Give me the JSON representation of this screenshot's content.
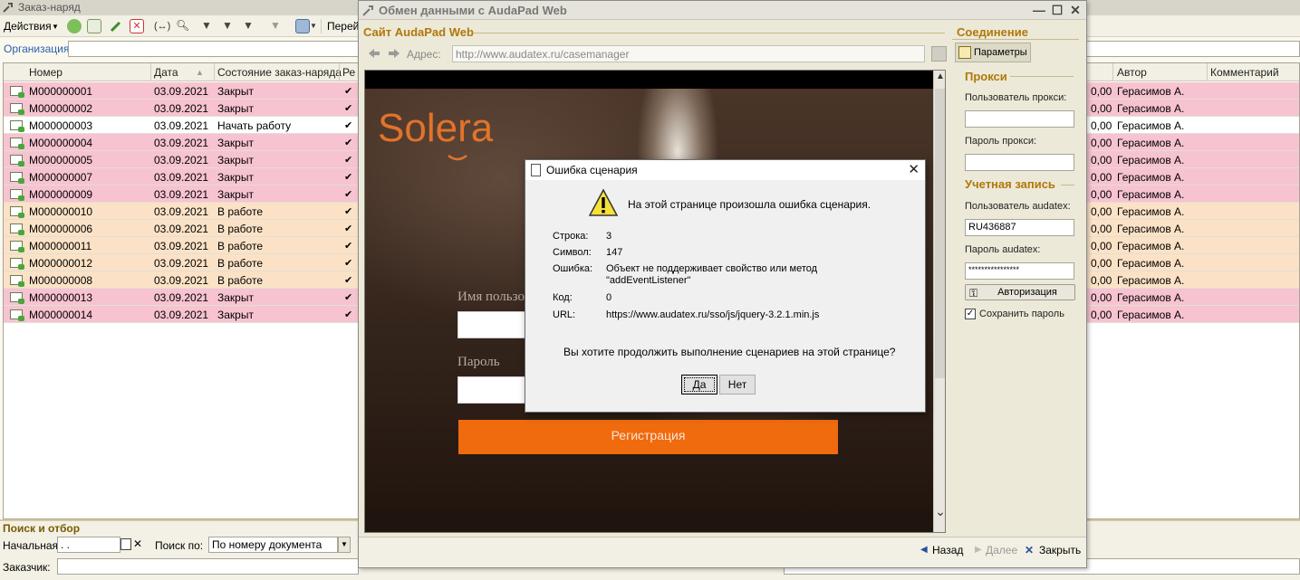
{
  "background": {
    "title": "Заказ-наряд",
    "toolbar": {
      "actions_label": "Действия",
      "goto_label": "Перей"
    },
    "org_label": "Организация:",
    "columns": [
      "Номер",
      "Дата",
      "Состояние заказ-наряда",
      "Ре",
      "Автор",
      "Комментарий"
    ],
    "rows": [
      {
        "number": "М000000001",
        "date": "03.09.2021",
        "state": "Закрыт",
        "sum": "0,00",
        "author": "Герасимов А.",
        "color": "pink"
      },
      {
        "number": "М000000002",
        "date": "03.09.2021",
        "state": "Закрыт",
        "sum": "0,00",
        "author": "Герасимов А.",
        "color": "pink"
      },
      {
        "number": "М000000003",
        "date": "03.09.2021",
        "state": "Начать работу",
        "sum": "0,00",
        "author": "Герасимов А.",
        "color": "white"
      },
      {
        "number": "М000000004",
        "date": "03.09.2021",
        "state": "Закрыт",
        "sum": "0,00",
        "author": "Герасимов А.",
        "color": "pink"
      },
      {
        "number": "М000000005",
        "date": "03.09.2021",
        "state": "Закрыт",
        "sum": "0,00",
        "author": "Герасимов А.",
        "color": "pink"
      },
      {
        "number": "М000000007",
        "date": "03.09.2021",
        "state": "Закрыт",
        "sum": "0,00",
        "author": "Герасимов А.",
        "color": "pink"
      },
      {
        "number": "М000000009",
        "date": "03.09.2021",
        "state": "Закрыт",
        "sum": "0,00",
        "author": "Герасимов А.",
        "color": "pink"
      },
      {
        "number": "М000000010",
        "date": "03.09.2021",
        "state": "В работе",
        "sum": "0,00",
        "author": "Герасимов А.",
        "color": "orange"
      },
      {
        "number": "М000000006",
        "date": "03.09.2021",
        "state": "В работе",
        "sum": "0,00",
        "author": "Герасимов А.",
        "color": "orange"
      },
      {
        "number": "М000000011",
        "date": "03.09.2021",
        "state": "В работе",
        "sum": "0,00",
        "author": "Герасимов А.",
        "color": "orange"
      },
      {
        "number": "М000000012",
        "date": "03.09.2021",
        "state": "В работе",
        "sum": "0,00",
        "author": "Герасимов А.",
        "color": "orange"
      },
      {
        "number": "М000000008",
        "date": "03.09.2021",
        "state": "В работе",
        "sum": "0,00",
        "author": "Герасимов А.",
        "color": "orange"
      },
      {
        "number": "М000000013",
        "date": "03.09.2021",
        "state": "Закрыт",
        "sum": "0,00",
        "author": "Герасимов А.",
        "color": "pink"
      },
      {
        "number": "М000000014",
        "date": "03.09.2021",
        "state": "Закрыт",
        "sum": "0,00",
        "author": "Герасимов А.",
        "color": "pink"
      }
    ],
    "search": {
      "header": "Поиск и отбор",
      "start_label": "Начальная с:",
      "start_value": ". .",
      "search_by_label": "Поиск по:",
      "search_by_value": "По номеру документа",
      "customer_label": "Заказчик:"
    }
  },
  "dialog": {
    "title": "Обмен данными с AudaPad Web",
    "site_header": "Сайт AudaPad Web",
    "address_label": "Адрес:",
    "address_value": "http://www.audatex.ru/casemanager",
    "browser": {
      "logo_text": "Solera",
      "user_label": "Имя пользо",
      "pass_label": "Пароль",
      "register_button": "Регистрация"
    },
    "right": {
      "connection_header": "Соединение",
      "params_button": "Параметры",
      "proxy_header": "Прокси",
      "proxy_user_label": "Пользователь прокси:",
      "proxy_user_value": "",
      "proxy_pass_label": "Пароль прокси:",
      "proxy_pass_value": "",
      "account_header": "Учетная запись",
      "audatex_user_label": "Пользователь audatex:",
      "audatex_user_value": "RU436887",
      "audatex_pass_label": "Пароль audatex:",
      "audatex_pass_value": "****************",
      "auth_button": "Авторизация",
      "save_password_label": "Сохранить пароль"
    },
    "bottom": {
      "back": "Назад",
      "next": "Далее",
      "close": "Закрыть"
    }
  },
  "error": {
    "title": "Ошибка сценария",
    "message": "На этой странице произошла ошибка сценария.",
    "line_label": "Строка:",
    "line_value": "3",
    "char_label": "Символ:",
    "char_value": "147",
    "error_label": "Ошибка:",
    "error_value_1": "Объект не поддерживает свойство или метод",
    "error_value_2": "\"addEventListener\"",
    "code_label": "Код:",
    "code_value": "0",
    "url_label": "URL:",
    "url_value": "https://www.audatex.ru/sso/js/jquery-3.2.1.min.js",
    "question": "Вы хотите продолжить выполнение сценариев на этой странице?",
    "yes": "Да",
    "no": "Нет"
  }
}
